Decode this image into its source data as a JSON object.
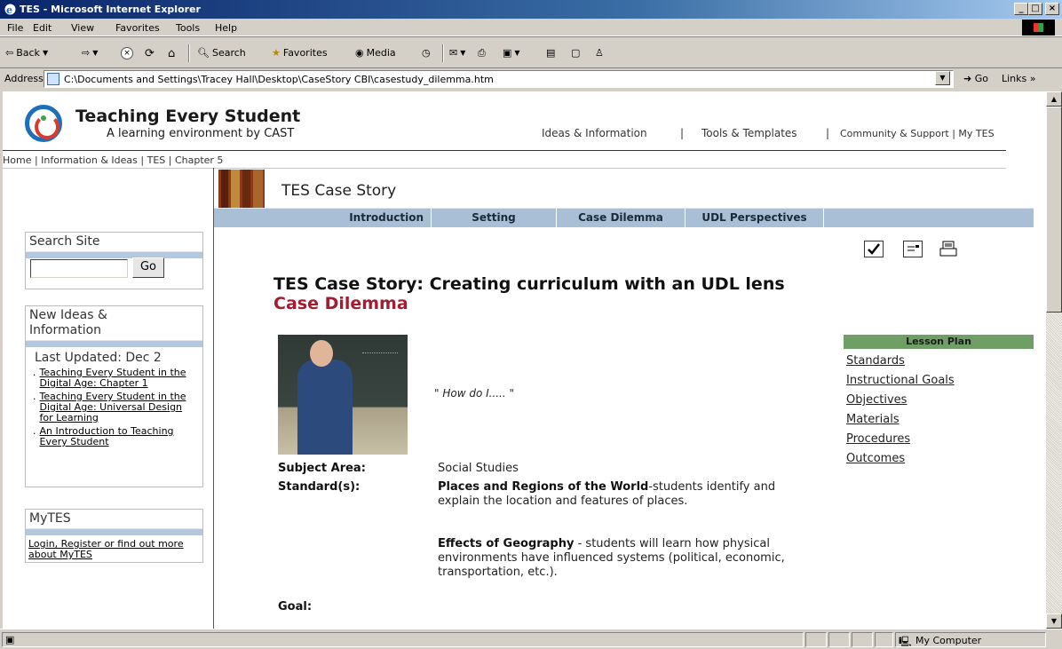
{
  "window": {
    "title": "TES - Microsoft Internet Explorer"
  },
  "menu": [
    "File",
    "Edit",
    "View",
    "Favorites",
    "Tools",
    "Help"
  ],
  "toolbar": {
    "back": "Back",
    "search": "Search",
    "favorites": "Favorites",
    "media": "Media"
  },
  "address": {
    "label": "Address",
    "url": "C:\\Documents and Settings\\Tracey Hall\\Desktop\\CaseStory CBI\\casestudy_dilemma.htm",
    "go": "Go",
    "links": "Links"
  },
  "status": {
    "zone": "My Computer"
  },
  "site": {
    "title": "Teaching Every Student",
    "subtitle": "A learning environment by CAST",
    "nav": [
      "Ideas & Information",
      "|",
      "Tools & Templates",
      "|",
      "Community & Support | My TES"
    ],
    "breadcrumb": "Home | Information & Ideas | TES | Chapter 5"
  },
  "sidebar": {
    "search_title": "Search Site",
    "search_button": "Go",
    "news_title": "New Ideas & Information",
    "last_updated": "Last Updated: Dec 2",
    "news_items": [
      "Teaching Every Student in the Digital Age: Chapter 1",
      "Teaching Every Student in the Digital Age: Universal Design for Learning",
      "An Introduction to Teaching Every Student"
    ],
    "mytes_title": "MyTES",
    "mytes_link": "Login, Register or find out more about MyTES"
  },
  "case": {
    "header": "TES Case Story",
    "tabs": [
      "Introduction",
      "Setting",
      "Case Dilemma",
      "UDL Perspectives"
    ],
    "title": "TES Case Story: Creating curriculum with an UDL lens",
    "subtitle": "Case Dilemma",
    "quote": "\" How do I..... \"",
    "lesson_plan": {
      "heading": "Lesson Plan",
      "links": [
        "Standards",
        "Instructional Goals",
        "Objectives",
        "Materials",
        "Procedures",
        "Outcomes"
      ]
    },
    "subject_label": "Subject Area:",
    "subject_value": "Social Studies",
    "standards_label": "Standard(s):",
    "standard1_title": "Places and Regions of the World",
    "standard1_text": "-students identify and explain the location and features of places.",
    "standard2_title": "Effects of Geography",
    "standard2_text": " - students will learn how physical environments have influenced systems (political, economic, transportation, etc.).",
    "goal_label": "Goal:"
  }
}
